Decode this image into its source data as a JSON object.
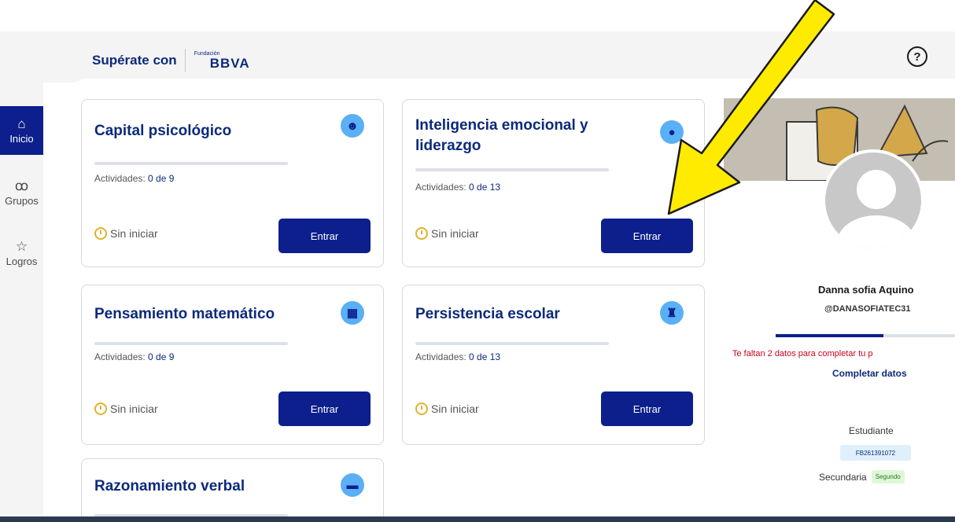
{
  "header": {
    "brand_text": "Supérate con",
    "logo_small": "Fundación",
    "logo_big": "BBVA",
    "help_icon": "?"
  },
  "sidebar": {
    "items": [
      {
        "label": "Inicio",
        "icon": "home-icon",
        "glyph": "⌂",
        "active": true
      },
      {
        "label": "Grupos",
        "icon": "group-icon",
        "glyph": "ꝏ",
        "active": false
      },
      {
        "label": "Logros",
        "icon": "star-icon",
        "glyph": "☆",
        "active": false
      }
    ]
  },
  "cards": [
    {
      "title": "Capital psicológico",
      "activities_label": "Actividades:",
      "activities_value": "0 de 9",
      "status": "Sin iniciar",
      "button": "Entrar",
      "icon": "brain-head-icon"
    },
    {
      "title": "Inteligencia emocional y liderazgo",
      "title_line1": "Inteligencia emocional y",
      "title_line2": "liderazgo",
      "activities_label": "Actividades:",
      "activities_value": "0 de 13",
      "status": "Sin iniciar",
      "button": "Entrar",
      "icon": "brain-icon"
    },
    {
      "title": "Pensamiento matemático",
      "activities_label": "Actividades:",
      "activities_value": "0 de 9",
      "status": "Sin iniciar",
      "button": "Entrar",
      "icon": "calculator-icon"
    },
    {
      "title": "Persistencia escolar",
      "activities_label": "Actividades:",
      "activities_value": "0 de 13",
      "status": "Sin iniciar",
      "button": "Entrar",
      "icon": "school-icon"
    },
    {
      "title": "Razonamiento verbal",
      "icon": "chat-icon"
    }
  ],
  "profile": {
    "name": "Danna sofia Aquino",
    "username": "@DANASOFIATEC31",
    "progress_fraction": 0.6,
    "warning": "Te faltan 2 datos para completar tu p",
    "complete_link": "Completar datos",
    "role": "Estudiante",
    "id": "FB261391072",
    "level": "Secundaria",
    "grade": "Segundo"
  },
  "colors": {
    "brand": "#0c1f8c",
    "accent_icon": "#5ab0f5",
    "status_clock": "#e2b22c",
    "warning": "#d0021b",
    "arrow": "#ffeb00"
  }
}
